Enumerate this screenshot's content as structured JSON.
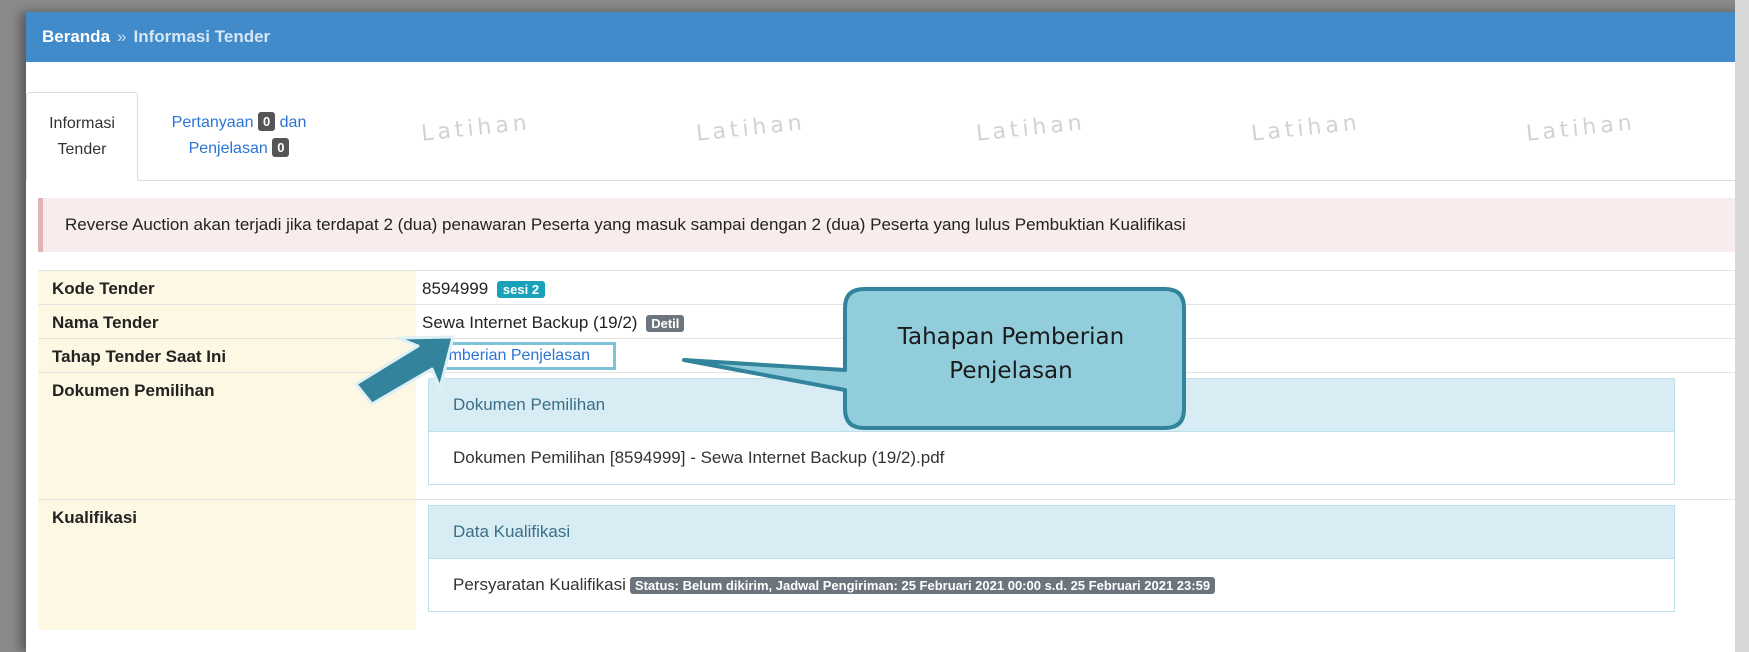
{
  "breadcrumb": {
    "home": "Beranda",
    "separator": "»",
    "current": "Informasi Tender"
  },
  "tabs": {
    "info_line1": "Informasi",
    "info_line2": "Tender",
    "tanya_text": "Pertanyaan",
    "tanya_count": "0",
    "tanya_and": "dan",
    "penjelasan_text": "Penjelasan",
    "penjelasan_count": "0"
  },
  "watermark": "Latihan",
  "alert": "Reverse Auction akan terjadi jika terdapat 2 (dua) penawaran Peserta yang masuk sampai dengan 2 (dua) Peserta yang lulus Pembuktian Kualifikasi",
  "rows": {
    "kode": {
      "label": "Kode Tender",
      "value": "8594999",
      "badge": "sesi 2"
    },
    "nama": {
      "label": "Nama Tender",
      "value": "Sewa Internet Backup (19/2)",
      "badge": "Detil"
    },
    "tahap": {
      "label": "Tahap Tender Saat Ini",
      "value": "Pemberian Penjelasan"
    },
    "dokumen": {
      "label": "Dokumen Pemilihan",
      "panel_title": "Dokumen Pemilihan",
      "file": "Dokumen Pemilihan [8594999] - Sewa Internet Backup (19/2).pdf"
    },
    "kualifikasi": {
      "label": "Kualifikasi",
      "panel_title": "Data Kualifikasi",
      "item": "Persyaratan Kualifikasi",
      "status": "Status: Belum dikirim, Jadwal Pengiriman: 25 Februari 2021 00:00 s.d. 25 Februari 2021 23:59"
    }
  },
  "callout": {
    "line1": "Tahapan Pemberian",
    "line2": "Penjelasan"
  },
  "colors": {
    "header": "#428bca",
    "label_bg": "#fcf8e3",
    "callout_fill": "#92cddc",
    "callout_border": "#31849b",
    "arrow": "#31849b"
  }
}
